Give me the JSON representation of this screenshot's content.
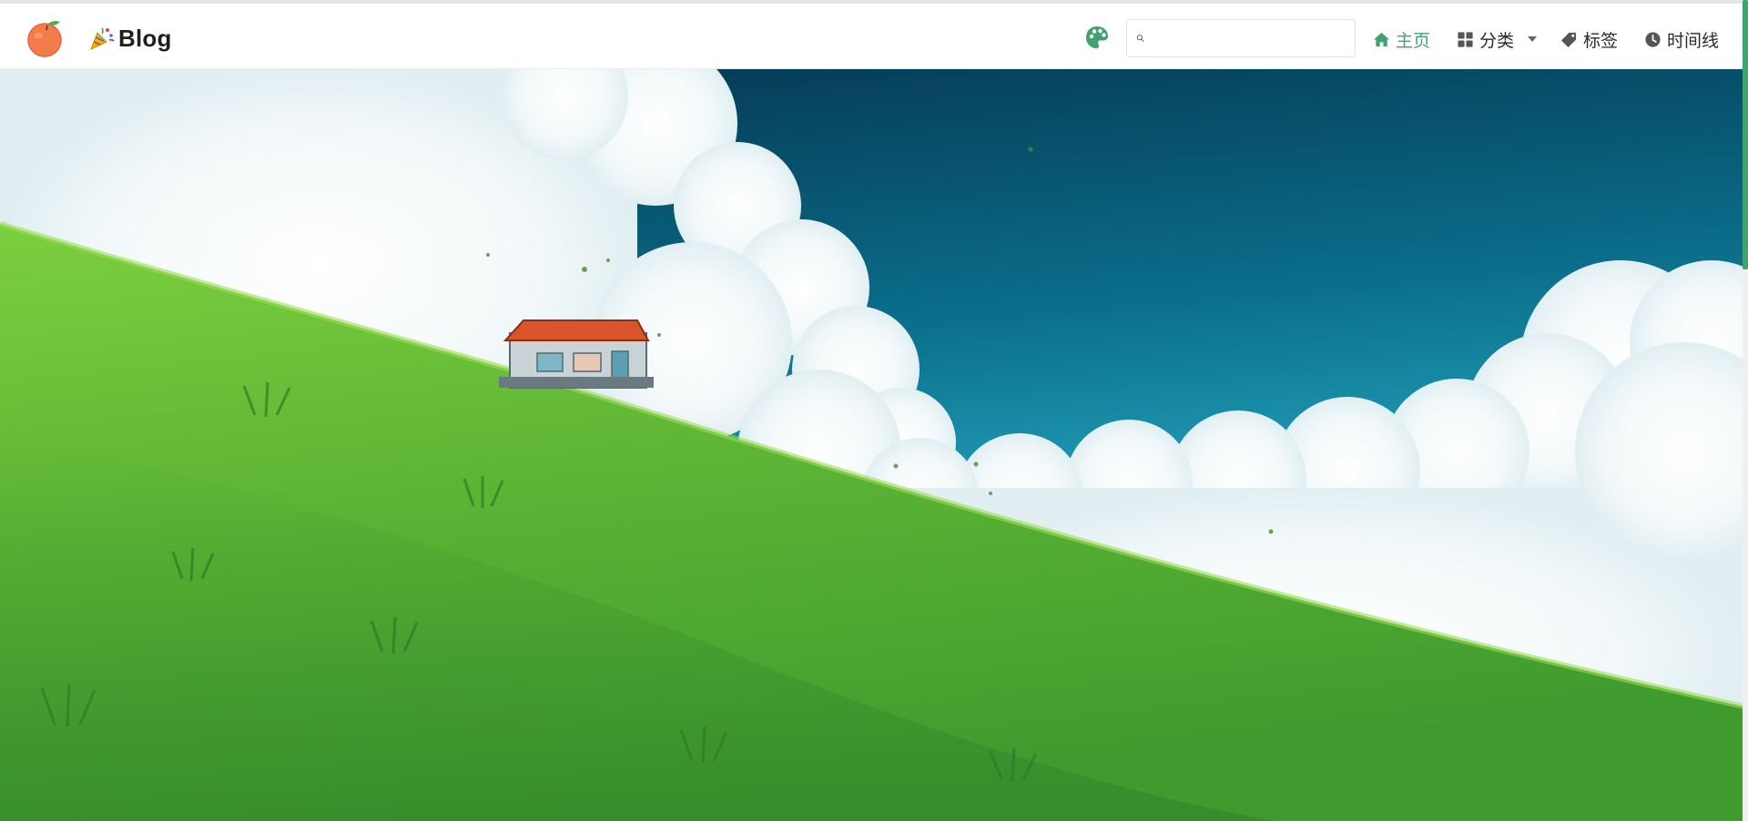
{
  "site": {
    "brand_text": "Blog"
  },
  "search": {
    "placeholder": ""
  },
  "nav": {
    "items": [
      {
        "label": "主页",
        "icon": "home-icon",
        "active": true
      },
      {
        "label": "分类",
        "icon": "grid-icon",
        "active": false,
        "dropdown": true
      },
      {
        "label": "标签",
        "icon": "tag-icon",
        "active": false
      },
      {
        "label": "时间线",
        "icon": "clock-icon",
        "active": false
      }
    ]
  },
  "colors": {
    "accent": "#43a06f",
    "text": "#2a2a2a",
    "sky_top": "#0a4a63",
    "sky_bottom": "#3cc4d8",
    "grass": "#5fb535"
  },
  "icons": {
    "logo": "orange-logo-icon",
    "brand": "party-popper-icon",
    "theme": "palette-icon",
    "search": "search-icon"
  }
}
